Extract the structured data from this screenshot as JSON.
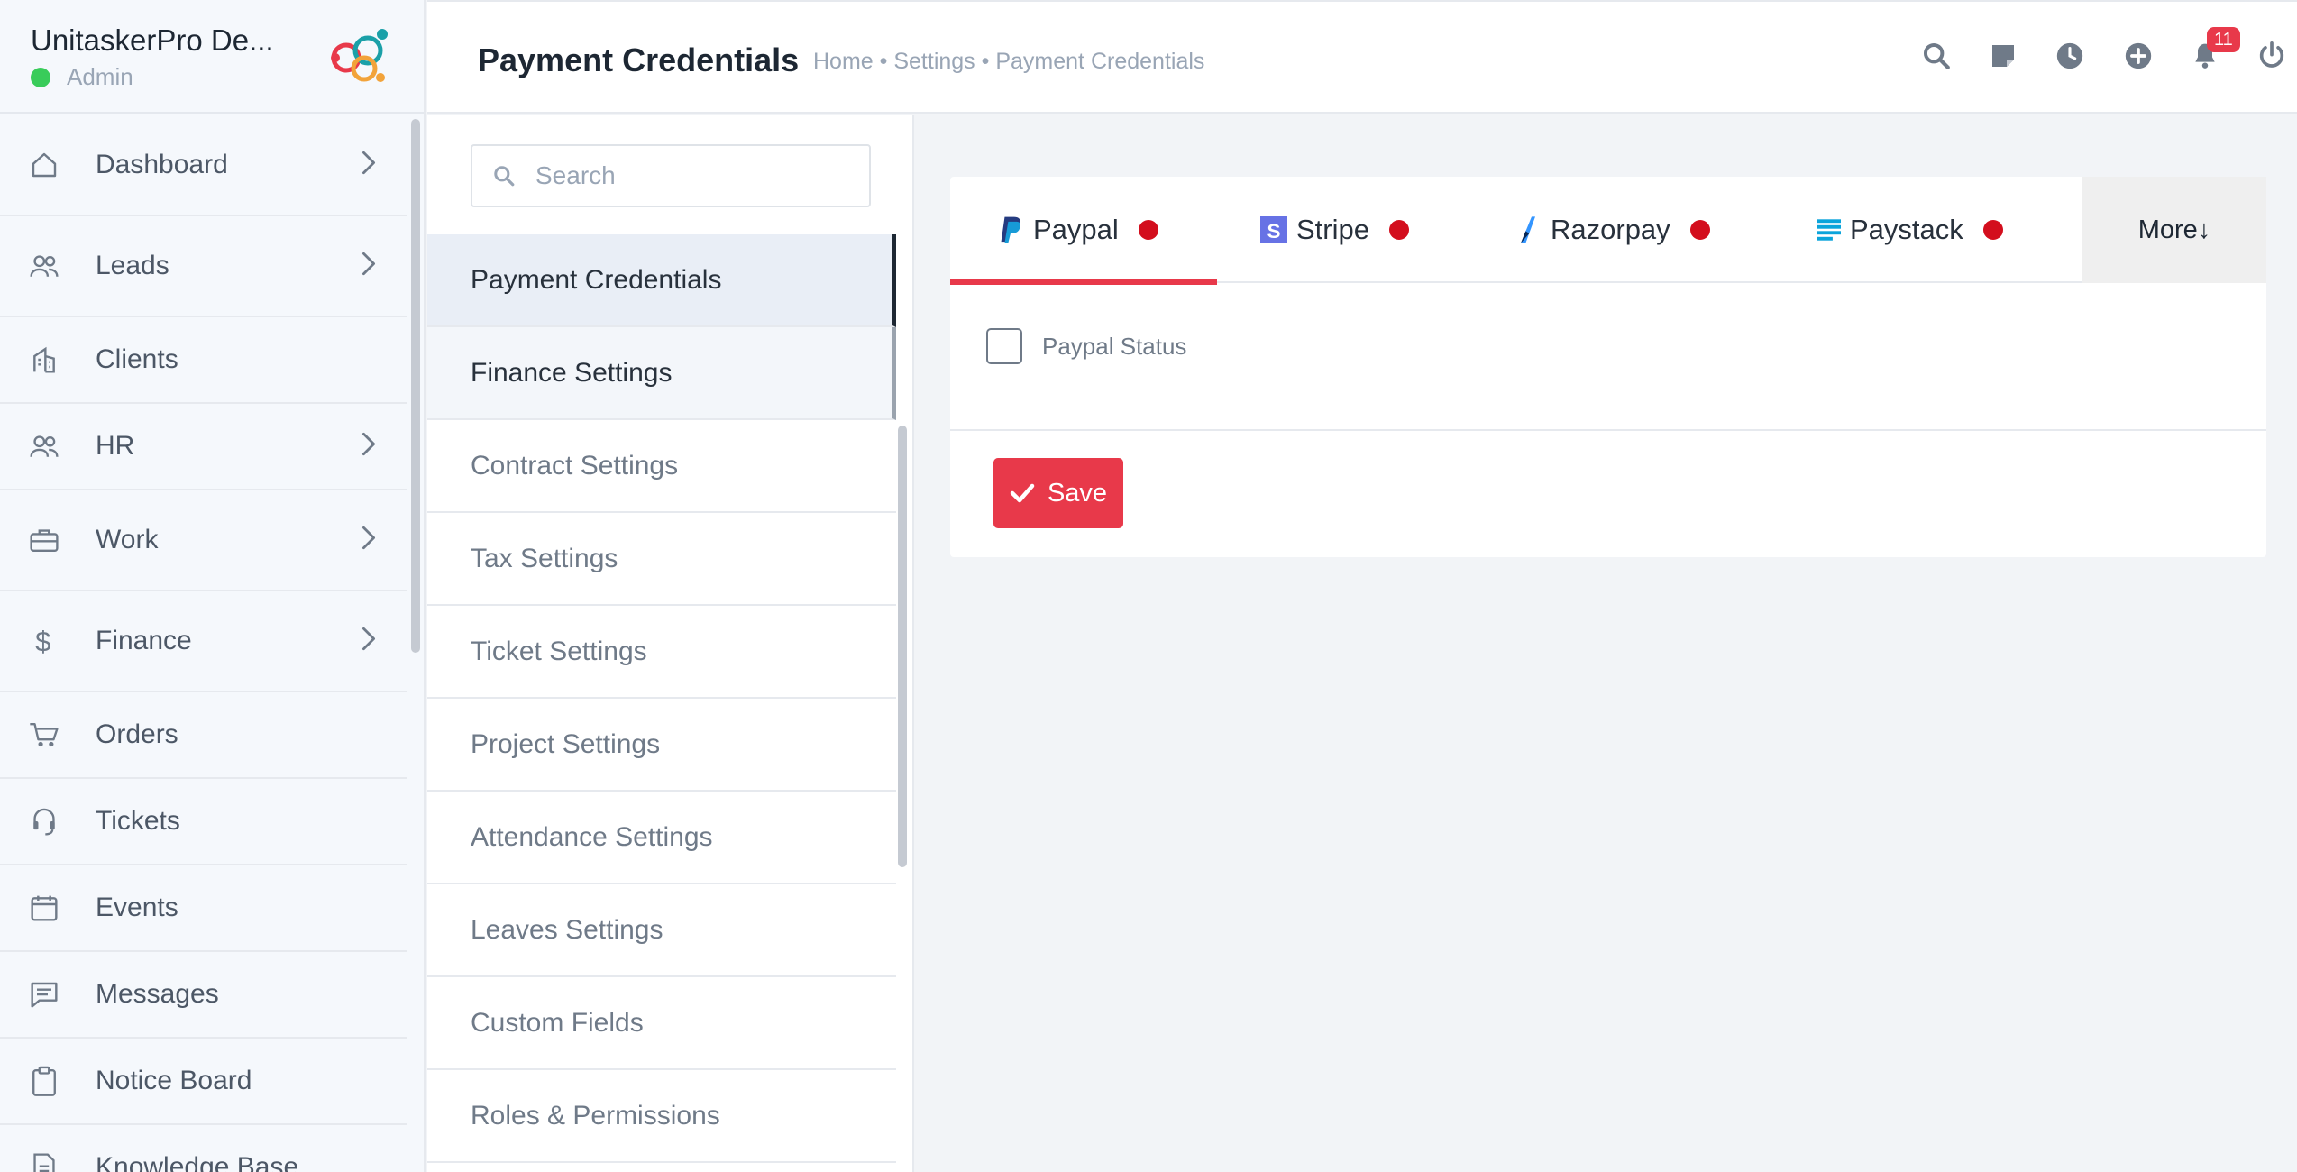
{
  "brand": {
    "name": "UnitaskerPro De...",
    "role": "Admin"
  },
  "sidebar": {
    "items": [
      {
        "label": "Dashboard",
        "icon": "home-icon",
        "chevron": true
      },
      {
        "label": "Leads",
        "icon": "users-icon",
        "chevron": true
      },
      {
        "label": "Clients",
        "icon": "building-icon",
        "chevron": false
      },
      {
        "label": "HR",
        "icon": "users-icon",
        "chevron": true
      },
      {
        "label": "Work",
        "icon": "briefcase-icon",
        "chevron": true
      },
      {
        "label": "Finance",
        "icon": "dollar-icon",
        "chevron": true
      },
      {
        "label": "Orders",
        "icon": "cart-icon",
        "chevron": false
      },
      {
        "label": "Tickets",
        "icon": "headset-icon",
        "chevron": false
      },
      {
        "label": "Events",
        "icon": "calendar-icon",
        "chevron": false
      },
      {
        "label": "Messages",
        "icon": "chat-icon",
        "chevron": false
      },
      {
        "label": "Notice Board",
        "icon": "clipboard-icon",
        "chevron": false
      },
      {
        "label": "Knowledge Base",
        "icon": "document-icon",
        "chevron": false
      }
    ]
  },
  "header": {
    "title": "Payment Credentials",
    "breadcrumb": [
      "Home",
      "Settings",
      "Payment Credentials"
    ],
    "breadcrumb_sep": " • ",
    "notification_count": "11"
  },
  "submenu": {
    "search_placeholder": "Search",
    "items": [
      "Payment Credentials",
      "Finance Settings",
      "Contract Settings",
      "Tax Settings",
      "Ticket Settings",
      "Project Settings",
      "Attendance Settings",
      "Leaves Settings",
      "Custom Fields",
      "Roles & Permissions"
    ],
    "active_index": 0,
    "hover_index": 1
  },
  "main": {
    "tabs": [
      {
        "label": "Paypal",
        "icon": "paypal-icon",
        "active": true
      },
      {
        "label": "Stripe",
        "icon": "stripe-icon",
        "active": false
      },
      {
        "label": "Razorpay",
        "icon": "razorpay-icon",
        "active": false
      },
      {
        "label": "Paystack",
        "icon": "paystack-icon",
        "active": false
      }
    ],
    "more_label": "More↓",
    "status_label": "Paypal Status",
    "status_checked": false,
    "save_label": "Save"
  },
  "colors": {
    "accent": "#e8394a",
    "status_dot": "#d30e1d",
    "online": "#39cc5a"
  }
}
